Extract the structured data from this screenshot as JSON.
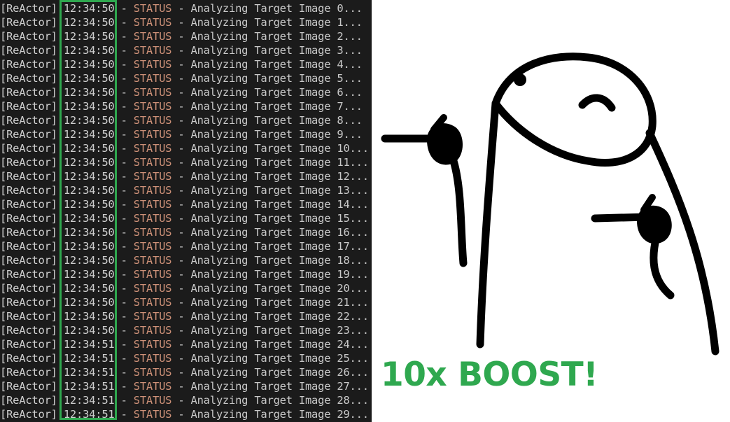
{
  "terminal": {
    "lines": [
      {
        "source": "[ReActor]",
        "time": "12:34:50",
        "level": "STATUS",
        "message": "Analyzing Target Image 0..."
      },
      {
        "source": "[ReActor]",
        "time": "12:34:50",
        "level": "STATUS",
        "message": "Analyzing Target Image 1..."
      },
      {
        "source": "[ReActor]",
        "time": "12:34:50",
        "level": "STATUS",
        "message": "Analyzing Target Image 2..."
      },
      {
        "source": "[ReActor]",
        "time": "12:34:50",
        "level": "STATUS",
        "message": "Analyzing Target Image 3..."
      },
      {
        "source": "[ReActor]",
        "time": "12:34:50",
        "level": "STATUS",
        "message": "Analyzing Target Image 4..."
      },
      {
        "source": "[ReActor]",
        "time": "12:34:50",
        "level": "STATUS",
        "message": "Analyzing Target Image 5..."
      },
      {
        "source": "[ReActor]",
        "time": "12:34:50",
        "level": "STATUS",
        "message": "Analyzing Target Image 6..."
      },
      {
        "source": "[ReActor]",
        "time": "12:34:50",
        "level": "STATUS",
        "message": "Analyzing Target Image 7..."
      },
      {
        "source": "[ReActor]",
        "time": "12:34:50",
        "level": "STATUS",
        "message": "Analyzing Target Image 8..."
      },
      {
        "source": "[ReActor]",
        "time": "12:34:50",
        "level": "STATUS",
        "message": "Analyzing Target Image 9..."
      },
      {
        "source": "[ReActor]",
        "time": "12:34:50",
        "level": "STATUS",
        "message": "Analyzing Target Image 10..."
      },
      {
        "source": "[ReActor]",
        "time": "12:34:50",
        "level": "STATUS",
        "message": "Analyzing Target Image 11..."
      },
      {
        "source": "[ReActor]",
        "time": "12:34:50",
        "level": "STATUS",
        "message": "Analyzing Target Image 12..."
      },
      {
        "source": "[ReActor]",
        "time": "12:34:50",
        "level": "STATUS",
        "message": "Analyzing Target Image 13..."
      },
      {
        "source": "[ReActor]",
        "time": "12:34:50",
        "level": "STATUS",
        "message": "Analyzing Target Image 14..."
      },
      {
        "source": "[ReActor]",
        "time": "12:34:50",
        "level": "STATUS",
        "message": "Analyzing Target Image 15..."
      },
      {
        "source": "[ReActor]",
        "time": "12:34:50",
        "level": "STATUS",
        "message": "Analyzing Target Image 16..."
      },
      {
        "source": "[ReActor]",
        "time": "12:34:50",
        "level": "STATUS",
        "message": "Analyzing Target Image 17..."
      },
      {
        "source": "[ReActor]",
        "time": "12:34:50",
        "level": "STATUS",
        "message": "Analyzing Target Image 18..."
      },
      {
        "source": "[ReActor]",
        "time": "12:34:50",
        "level": "STATUS",
        "message": "Analyzing Target Image 19..."
      },
      {
        "source": "[ReActor]",
        "time": "12:34:50",
        "level": "STATUS",
        "message": "Analyzing Target Image 20..."
      },
      {
        "source": "[ReActor]",
        "time": "12:34:50",
        "level": "STATUS",
        "message": "Analyzing Target Image 21..."
      },
      {
        "source": "[ReActor]",
        "time": "12:34:50",
        "level": "STATUS",
        "message": "Analyzing Target Image 22..."
      },
      {
        "source": "[ReActor]",
        "time": "12:34:50",
        "level": "STATUS",
        "message": "Analyzing Target Image 23..."
      },
      {
        "source": "[ReActor]",
        "time": "12:34:51",
        "level": "STATUS",
        "message": "Analyzing Target Image 24..."
      },
      {
        "source": "[ReActor]",
        "time": "12:34:51",
        "level": "STATUS",
        "message": "Analyzing Target Image 25..."
      },
      {
        "source": "[ReActor]",
        "time": "12:34:51",
        "level": "STATUS",
        "message": "Analyzing Target Image 26..."
      },
      {
        "source": "[ReActor]",
        "time": "12:34:51",
        "level": "STATUS",
        "message": "Analyzing Target Image 27..."
      },
      {
        "source": "[ReActor]",
        "time": "12:34:51",
        "level": "STATUS",
        "message": "Analyzing Target Image 28..."
      },
      {
        "source": "[ReActor]",
        "time": "12:34:51",
        "level": "STATUS",
        "message": "Analyzing Target Image 29..."
      }
    ],
    "highlight_color": "#2fa84f",
    "level_color": "#ce9178"
  },
  "meme": {
    "figure": "shrugging-pointing-character",
    "caption": "10x BOOST!",
    "caption_color": "#2fa84f"
  }
}
